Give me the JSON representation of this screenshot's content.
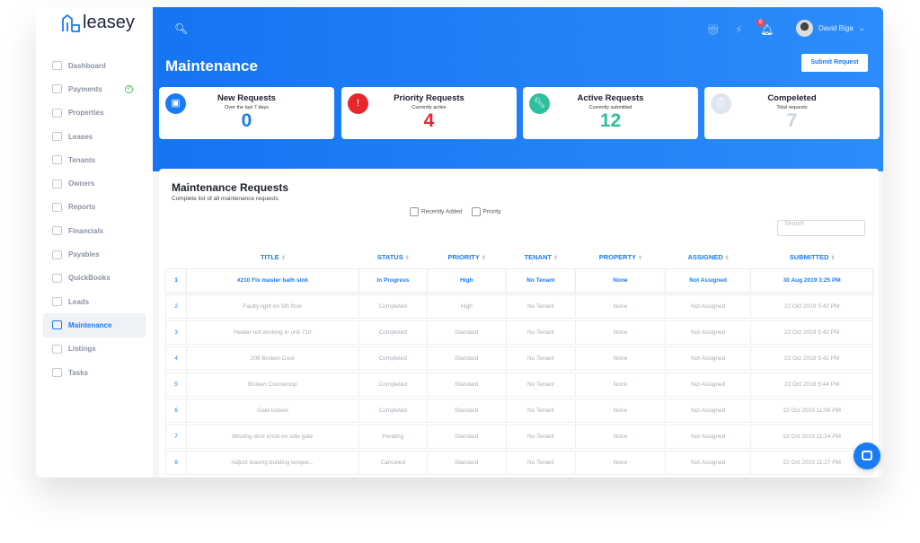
{
  "brand": "leasey",
  "sidebar": {
    "items": [
      {
        "label": "Dashboard",
        "icon": "bar-chart-icon"
      },
      {
        "label": "Payments",
        "icon": "credit-card-icon",
        "check": true
      },
      {
        "label": "Properties",
        "icon": "home-icon"
      },
      {
        "label": "Leases",
        "icon": "document-icon"
      },
      {
        "label": "Tenants",
        "icon": "user-icon"
      },
      {
        "label": "Owners",
        "icon": "owners-icon"
      },
      {
        "label": "Reports",
        "icon": "reports-icon"
      },
      {
        "label": "Financials",
        "icon": "line-chart-icon"
      },
      {
        "label": "Payables",
        "icon": "wallet-icon"
      },
      {
        "label": "QuickBooks",
        "icon": "search-icon"
      },
      {
        "label": "Leads",
        "icon": "star-icon"
      },
      {
        "label": "Maintenance",
        "icon": "wrench-icon",
        "active": true
      },
      {
        "label": "Listings",
        "icon": "video-icon"
      },
      {
        "label": "Tasks",
        "icon": "grid-icon"
      }
    ]
  },
  "header": {
    "title": "Maintenance",
    "user": "David Biga",
    "notifications": "6",
    "submit_label": "Submit Request"
  },
  "stats": [
    {
      "title": "New Requests",
      "sub": "Over the last 7 days",
      "value": "0",
      "color": "#1a7cf5"
    },
    {
      "title": "Priority Requests",
      "sub": "Currently active",
      "value": "4",
      "color": "#e8262e"
    },
    {
      "title": "Active Requests",
      "sub": "Currently submitted",
      "value": "12",
      "color": "#2fbf9e"
    },
    {
      "title": "Compeleted",
      "sub": "Total requests",
      "value": "7",
      "color": "#ccd4e0"
    }
  ],
  "panel": {
    "title": "Maintenance Requests",
    "subtitle": "Complete list of all maintenance requests",
    "filter_recent": "Recently Added",
    "filter_priority": "Priority",
    "search_placeholder": "Search"
  },
  "table": {
    "columns": [
      "TITLE",
      "STATUS",
      "PRIORITY",
      "TENANT",
      "PROPERTY",
      "ASSIGNED",
      "SUBMITTED"
    ],
    "rows": [
      [
        "1",
        "#210 Fix master bath sink",
        "In Progress",
        "High",
        "No Tenant",
        "None",
        "Not Assigned",
        "30 Aug 2019 3:25 PM"
      ],
      [
        "2",
        "Faulty light on 5th floor",
        "Completed",
        "High",
        "No Tenant",
        "None",
        "Not Assigned",
        "22 Oct 2019 5:42 PM"
      ],
      [
        "3",
        "Heater not working in unit 710",
        "Completed",
        "Standard",
        "No Tenant",
        "None",
        "Not Assigned",
        "22 Oct 2019 5:42 PM"
      ],
      [
        "4",
        "209 Broken Door",
        "Completed",
        "Standard",
        "No Tenant",
        "None",
        "Not Assigned",
        "22 Oct 2019 5:42 PM"
      ],
      [
        "5",
        "Broken Countertop",
        "Completed",
        "Standard",
        "No Tenant",
        "None",
        "Not Assigned",
        "22 Oct 2019 5:44 PM"
      ],
      [
        "6",
        "Gate locked",
        "Completed",
        "Standard",
        "No Tenant",
        "None",
        "Not Assigned",
        "22 Oct 2019 11:06 PM"
      ],
      [
        "7",
        "Missing door knob on side gate",
        "Pending",
        "Standard",
        "No Tenant",
        "None",
        "Not Assigned",
        "22 Oct 2019 11:14 PM"
      ],
      [
        "8",
        "Adjust leasing building temper...",
        "Canceled",
        "Standard",
        "No Tenant",
        "None",
        "Not Assigned",
        "22 Oct 2019 11:27 PM"
      ]
    ]
  }
}
